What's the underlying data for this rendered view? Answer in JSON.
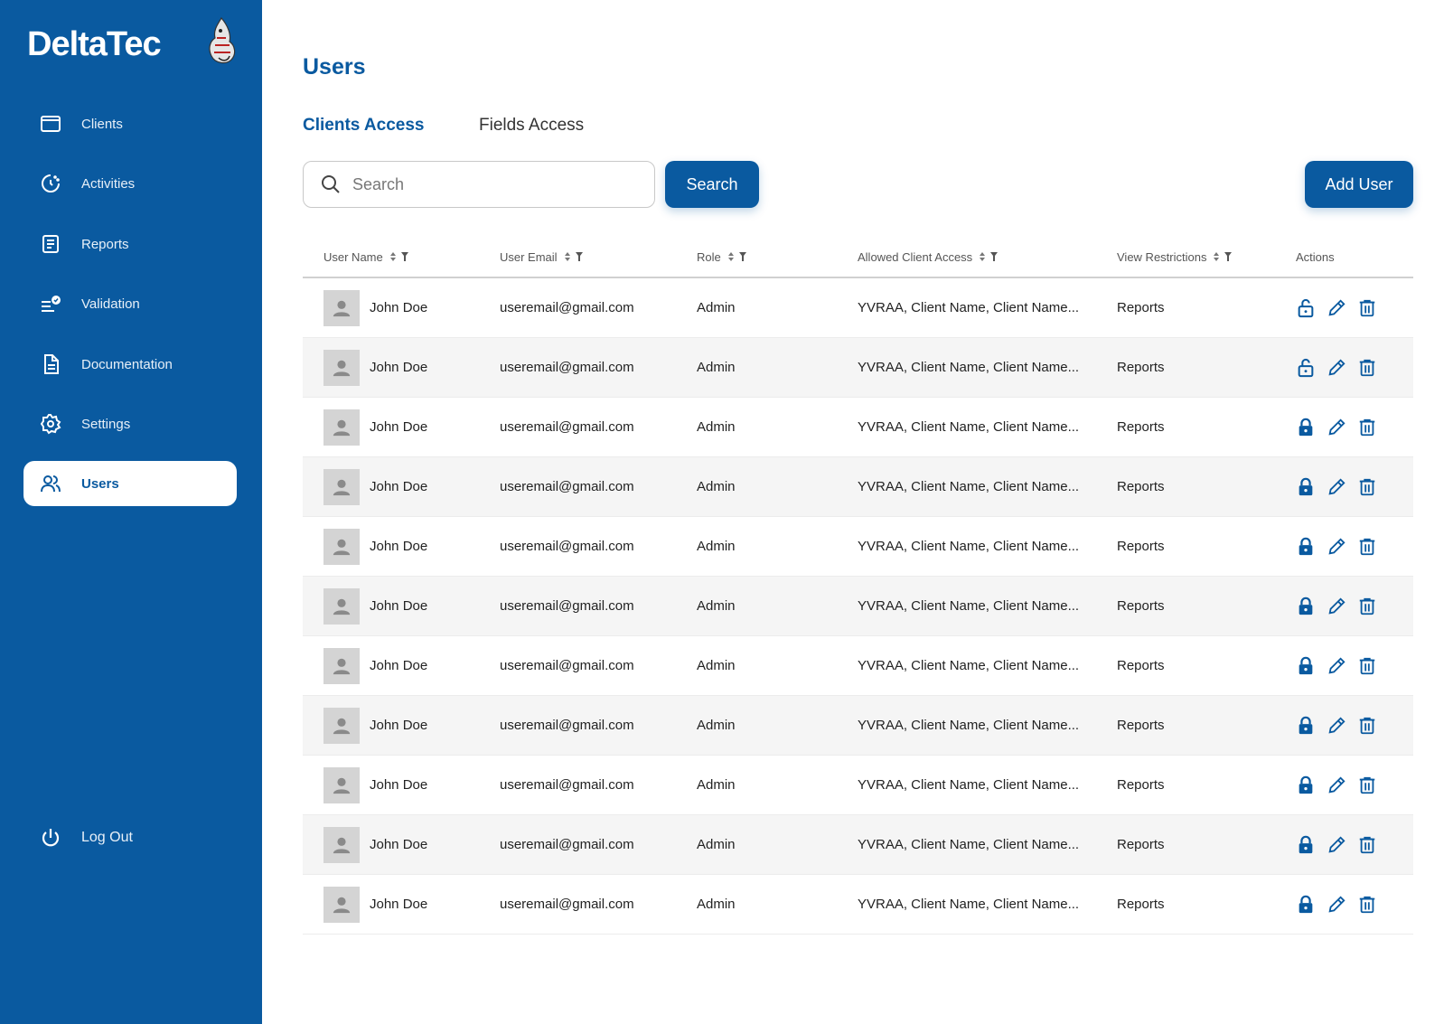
{
  "app": {
    "brand": "DeltaTec"
  },
  "sidebar": {
    "items": [
      {
        "label": "Clients",
        "icon": "window-icon"
      },
      {
        "label": "Activities",
        "icon": "activity-icon"
      },
      {
        "label": "Reports",
        "icon": "report-icon"
      },
      {
        "label": "Validation",
        "icon": "validation-icon"
      },
      {
        "label": "Documentation",
        "icon": "document-icon"
      },
      {
        "label": "Settings",
        "icon": "gear-icon"
      },
      {
        "label": "Users",
        "icon": "users-icon",
        "active": true
      }
    ],
    "logout_label": "Log Out"
  },
  "main": {
    "title": "Users",
    "tabs": [
      {
        "label": "Clients Access",
        "active": true
      },
      {
        "label": "Fields Access",
        "active": false
      }
    ],
    "search": {
      "placeholder": "Search",
      "button_label": "Search"
    },
    "add_user_label": "Add User"
  },
  "table": {
    "headers": [
      "User Name",
      "User Email",
      "Role",
      "Allowed Client Access",
      "View Restrictions",
      "Actions"
    ],
    "rows": [
      {
        "name": "John Doe",
        "email": "useremail@gmail.com",
        "role": "Admin",
        "access": "YVRAA, Client Name, Client Name...",
        "restrictions": "Reports",
        "locked": false
      },
      {
        "name": "John Doe",
        "email": "useremail@gmail.com",
        "role": "Admin",
        "access": "YVRAA, Client Name, Client Name...",
        "restrictions": "Reports",
        "locked": false
      },
      {
        "name": "John Doe",
        "email": "useremail@gmail.com",
        "role": "Admin",
        "access": "YVRAA, Client Name, Client Name...",
        "restrictions": "Reports",
        "locked": true
      },
      {
        "name": "John Doe",
        "email": "useremail@gmail.com",
        "role": "Admin",
        "access": "YVRAA, Client Name, Client Name...",
        "restrictions": "Reports",
        "locked": true
      },
      {
        "name": "John Doe",
        "email": "useremail@gmail.com",
        "role": "Admin",
        "access": "YVRAA, Client Name, Client Name...",
        "restrictions": "Reports",
        "locked": true
      },
      {
        "name": "John Doe",
        "email": "useremail@gmail.com",
        "role": "Admin",
        "access": "YVRAA, Client Name, Client Name...",
        "restrictions": "Reports",
        "locked": true
      },
      {
        "name": "John Doe",
        "email": "useremail@gmail.com",
        "role": "Admin",
        "access": "YVRAA, Client Name, Client Name...",
        "restrictions": "Reports",
        "locked": true
      },
      {
        "name": "John Doe",
        "email": "useremail@gmail.com",
        "role": "Admin",
        "access": "YVRAA, Client Name, Client Name...",
        "restrictions": "Reports",
        "locked": true
      },
      {
        "name": "John Doe",
        "email": "useremail@gmail.com",
        "role": "Admin",
        "access": "YVRAA, Client Name, Client Name...",
        "restrictions": "Reports",
        "locked": true
      },
      {
        "name": "John Doe",
        "email": "useremail@gmail.com",
        "role": "Admin",
        "access": "YVRAA, Client Name, Client Name...",
        "restrictions": "Reports",
        "locked": true
      },
      {
        "name": "John Doe",
        "email": "useremail@gmail.com",
        "role": "Admin",
        "access": "YVRAA, Client Name, Client Name...",
        "restrictions": "Reports",
        "locked": true
      }
    ]
  },
  "colors": {
    "primary": "#0a5aa0",
    "row_alt": "#f5f5f5",
    "avatar_bg": "#d4d4d4"
  }
}
